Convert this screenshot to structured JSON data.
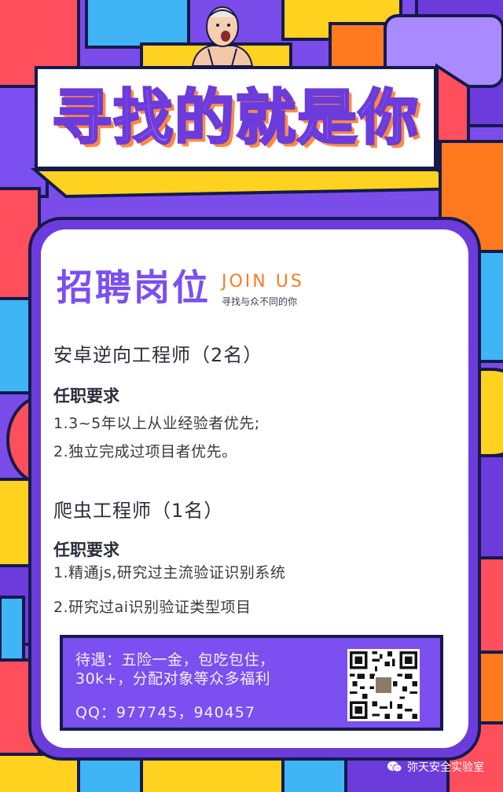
{
  "title": "寻找的就是你",
  "header": {
    "title": "招聘岗位",
    "join": "JOIN US",
    "subtitle": "寻找与众不同的你"
  },
  "jobs": [
    {
      "title": "安卓逆向工程师（2名）",
      "req_label": "任职要求",
      "lines": [
        "1.3~5年以上从业经验者优先;",
        "2.独立完成过项目者优先。"
      ]
    },
    {
      "title": "爬虫工程师（1名）",
      "req_label": "任职要求",
      "lines": [
        "1.精通js,研究过主流验证识别系统",
        "2.研究过ai识别验证类型项目"
      ]
    }
  ],
  "benefits": {
    "line1": "待遇：五险一金，包吃包住，",
    "line2": "30k+，分配对象等众多福利",
    "qq": "QQ：977745，940457"
  },
  "footer": {
    "icon": "wechat-icon",
    "label": "弥天安全实验室"
  },
  "colors": {
    "purple": "#7b4ff0",
    "orange": "#ff7a1f",
    "navy": "#151a4b",
    "yellow": "#ffd21f",
    "red": "#ff4e5c",
    "blue": "#3fb5f5"
  }
}
